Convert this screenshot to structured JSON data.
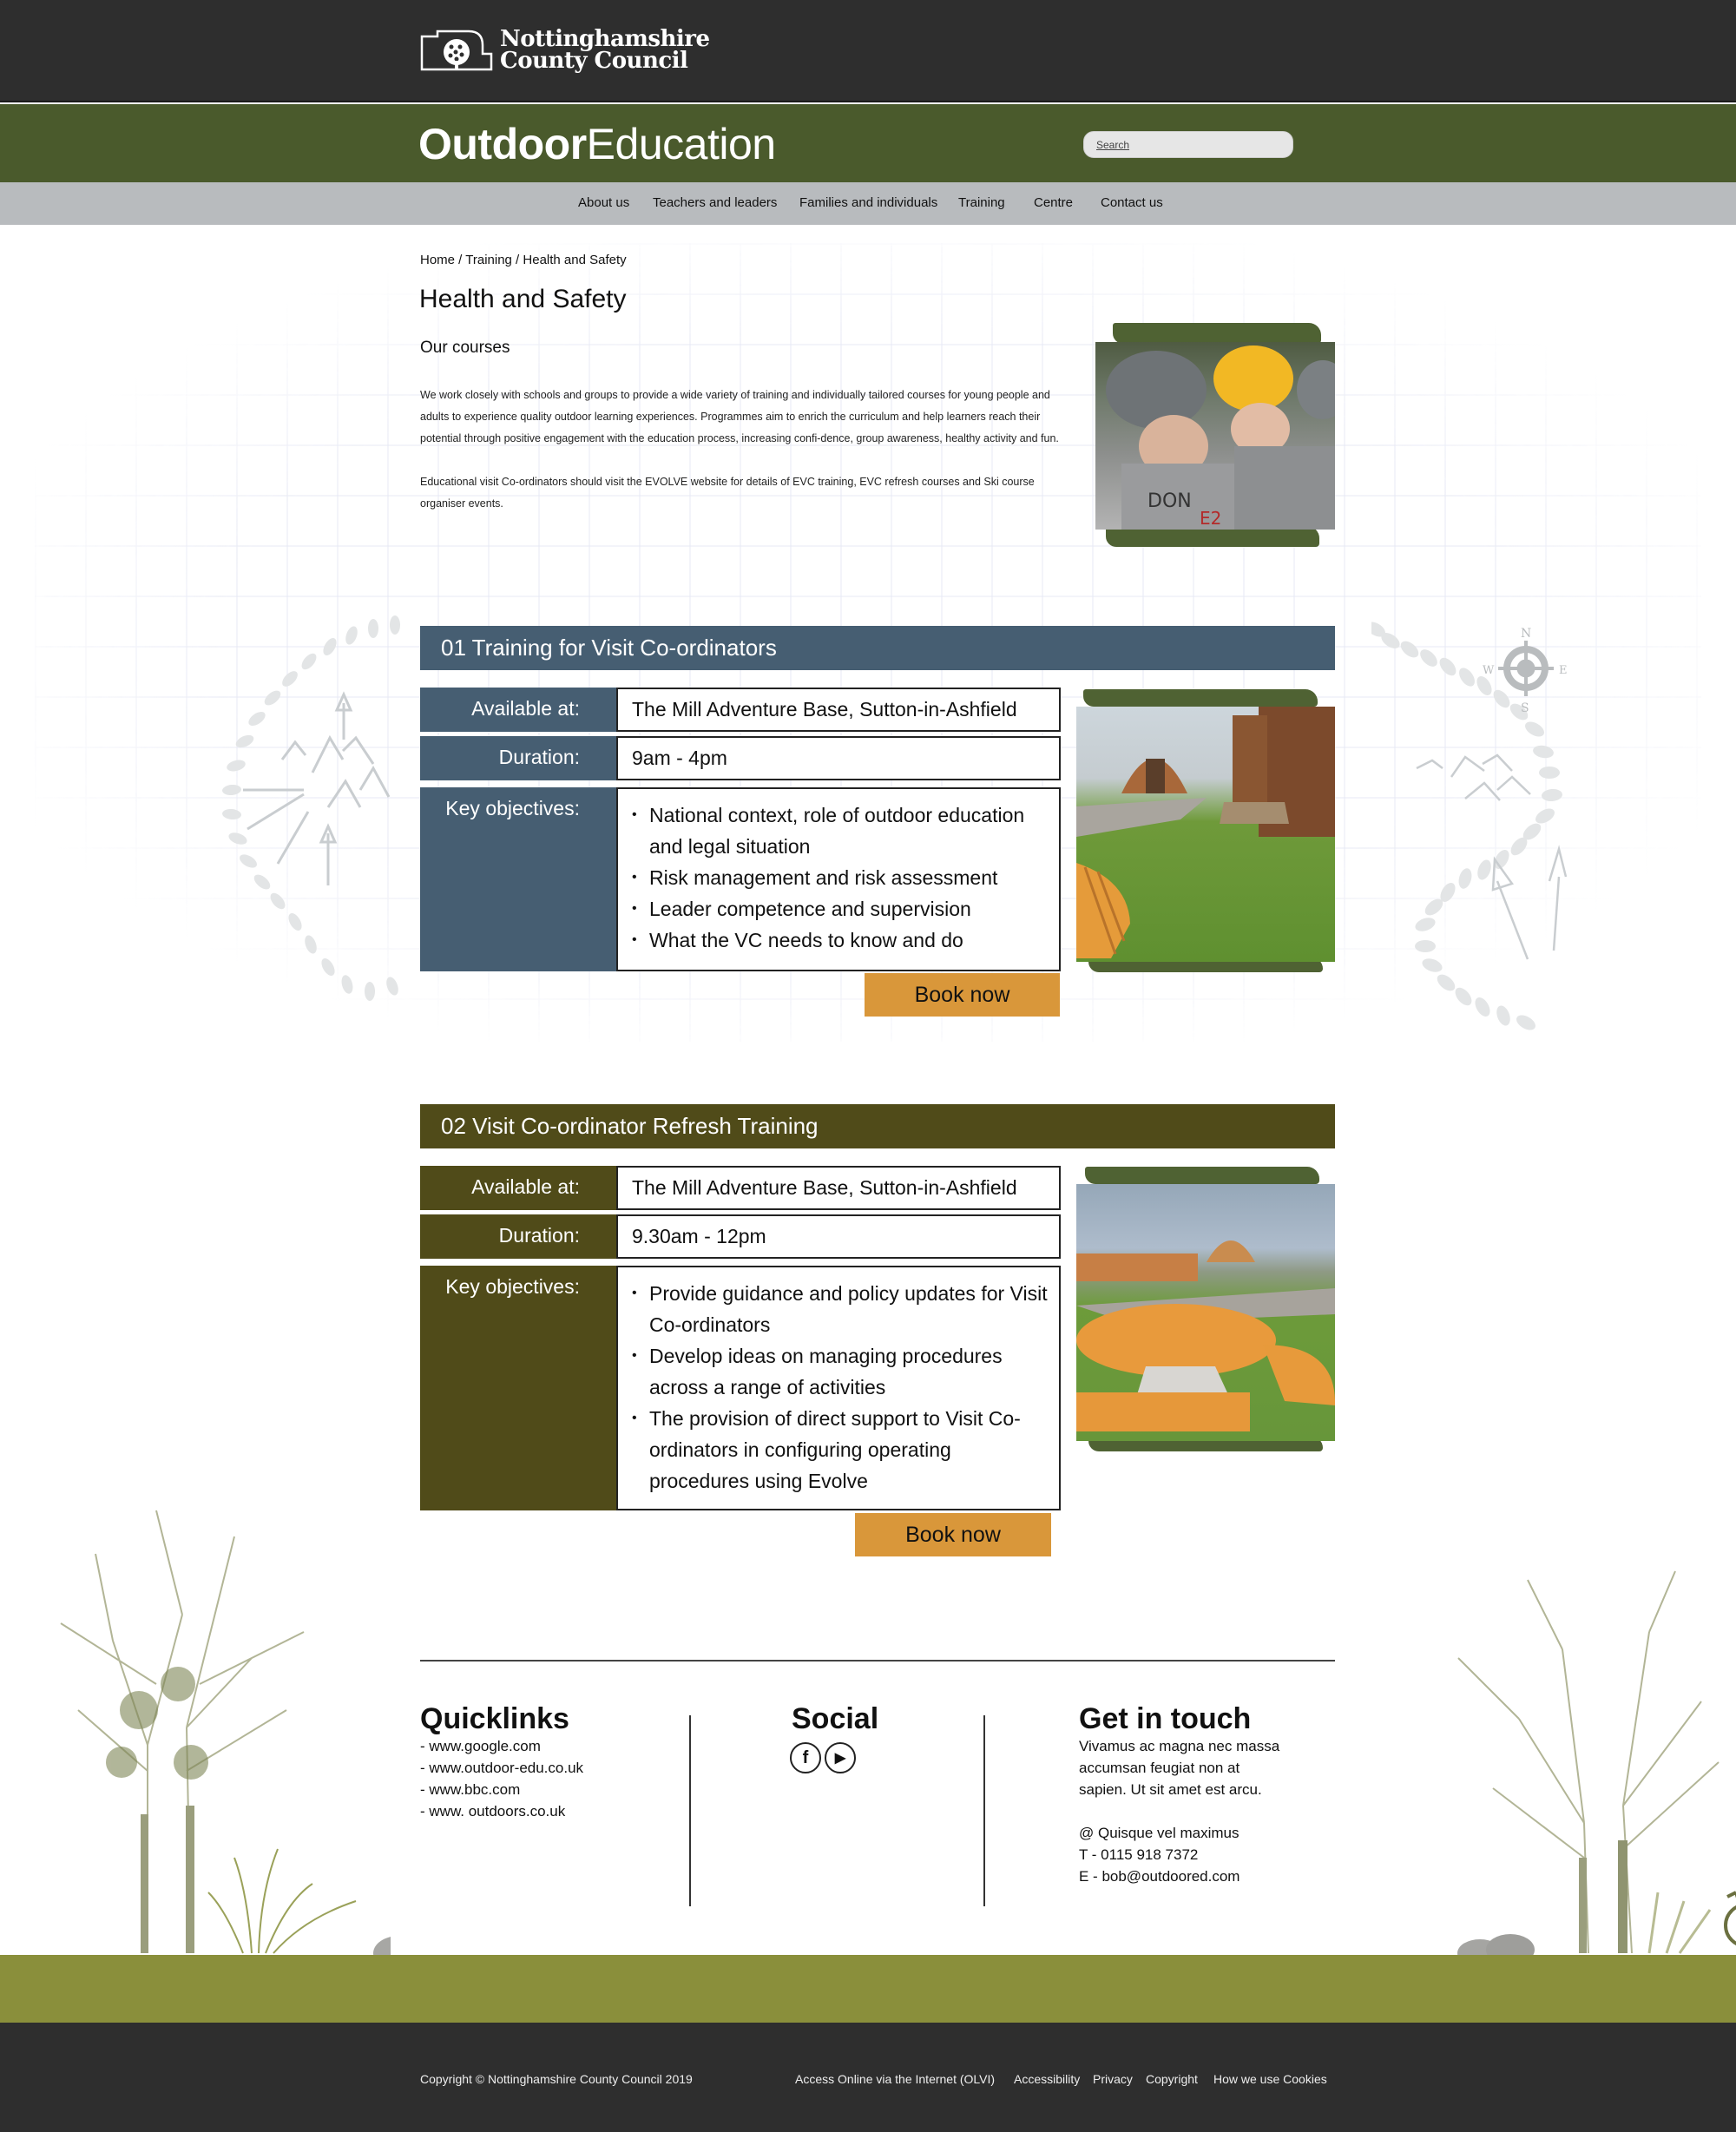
{
  "council": {
    "name_line1": "Nottinghamshire",
    "name_line2": "County Council"
  },
  "brand": {
    "bold": "Outdoor",
    "light": "Education"
  },
  "search": {
    "placeholder": "Search",
    "value": ""
  },
  "nav": {
    "items": [
      {
        "label": "About us"
      },
      {
        "label": "Teachers and leaders"
      },
      {
        "label": "Families and individuals"
      },
      {
        "label": "Training"
      },
      {
        "label": "Centre"
      },
      {
        "label": "Contact us"
      }
    ]
  },
  "breadcrumb": {
    "home": "Home",
    "sep": " / ",
    "training": "Training",
    "current": "Health and Safety"
  },
  "page": {
    "title": "Health and Safety",
    "subtitle": "Our courses",
    "intro": [
      "We work closely with schools and groups to provide a wide variety of training and individually tailored courses for young people and adults to experience quality outdoor learning experiences. Programmes aim to enrich the curriculum and help learners reach their potential through positive engagement with the education process, increasing confi-dence, group awareness, healthy activity and fun.",
      "Educational visit Co-ordinators should visit the EVOLVE website for details of EVC training, EVC refresh courses and Ski course organiser events."
    ],
    "intro_photo_alt": "Children wearing climbing helmets helping each other"
  },
  "courses": [
    {
      "title": "01 Training for Visit Co-ordinators",
      "color": "#465e72",
      "available_label": "Available at:",
      "available_value": "The Mill Adventure Base, Sutton-in-Ashfield",
      "duration_label": "Duration:",
      "duration_value": "9am - 4pm",
      "objectives_label": "Key objectives:",
      "objectives": [
        "National context, role of outdoor education and legal situation",
        "Risk management and risk assessment",
        "Leader competence and supervision",
        "What the VC needs to know and do"
      ],
      "book_label": "Book now",
      "photo_alt": "Camping pods on grass with wooden bench"
    },
    {
      "title": "02 Visit Co-ordinator Refresh Training",
      "color": "#504b19",
      "available_label": "Available at:",
      "available_value": "The Mill Adventure Base, Sutton-in-Ashfield",
      "duration_label": "Duration:",
      "duration_value": "9.30am - 12pm",
      "objectives_label": "Key objectives:",
      "objectives": [
        "Provide guidance and policy updates for Visit Co-ordinators",
        "Develop ideas on managing procedures across a range of activities",
        "The provision of direct support to Visit Co-ordinators in configuring operating procedures using Evolve"
      ],
      "book_label": "Book now",
      "photo_alt": "Wooden picnic table in front of camping pods"
    }
  ],
  "footer": {
    "quicklinks": {
      "title": "Quicklinks",
      "links": [
        "- www.google.com",
        "- www.outdoor-edu.co.uk",
        "- www.bbc.com",
        "- www. outdoors.co.uk"
      ]
    },
    "social": {
      "title": "Social",
      "icons": [
        "facebook-icon",
        "youtube-play-icon"
      ]
    },
    "contact": {
      "title": "Get in touch",
      "text": [
        "Vivamus ac magna nec massa",
        "accumsan feugiat non at",
        "sapien. Ut sit amet est arcu."
      ],
      "lines": [
        "@ Quisque vel maximus",
        "T - 0115 918 7372",
        "E - bob@outdoored.com"
      ]
    }
  },
  "bottom": {
    "copyright": "Copyright © Nottinghamshire County Council 2019",
    "links": [
      "Access Online via the Internet (OLVI)",
      "Accessibility",
      "Privacy",
      "Copyright",
      "How we use Cookies"
    ]
  },
  "colors": {
    "council_bar": "#2e2e2e",
    "brand_green": "#4a5a2c",
    "nav_grey": "#b8bbbe",
    "course1_blue": "#465e72",
    "course2_olive": "#504b19",
    "book_button": "#d9973a",
    "ground": "#8a8f3b"
  }
}
